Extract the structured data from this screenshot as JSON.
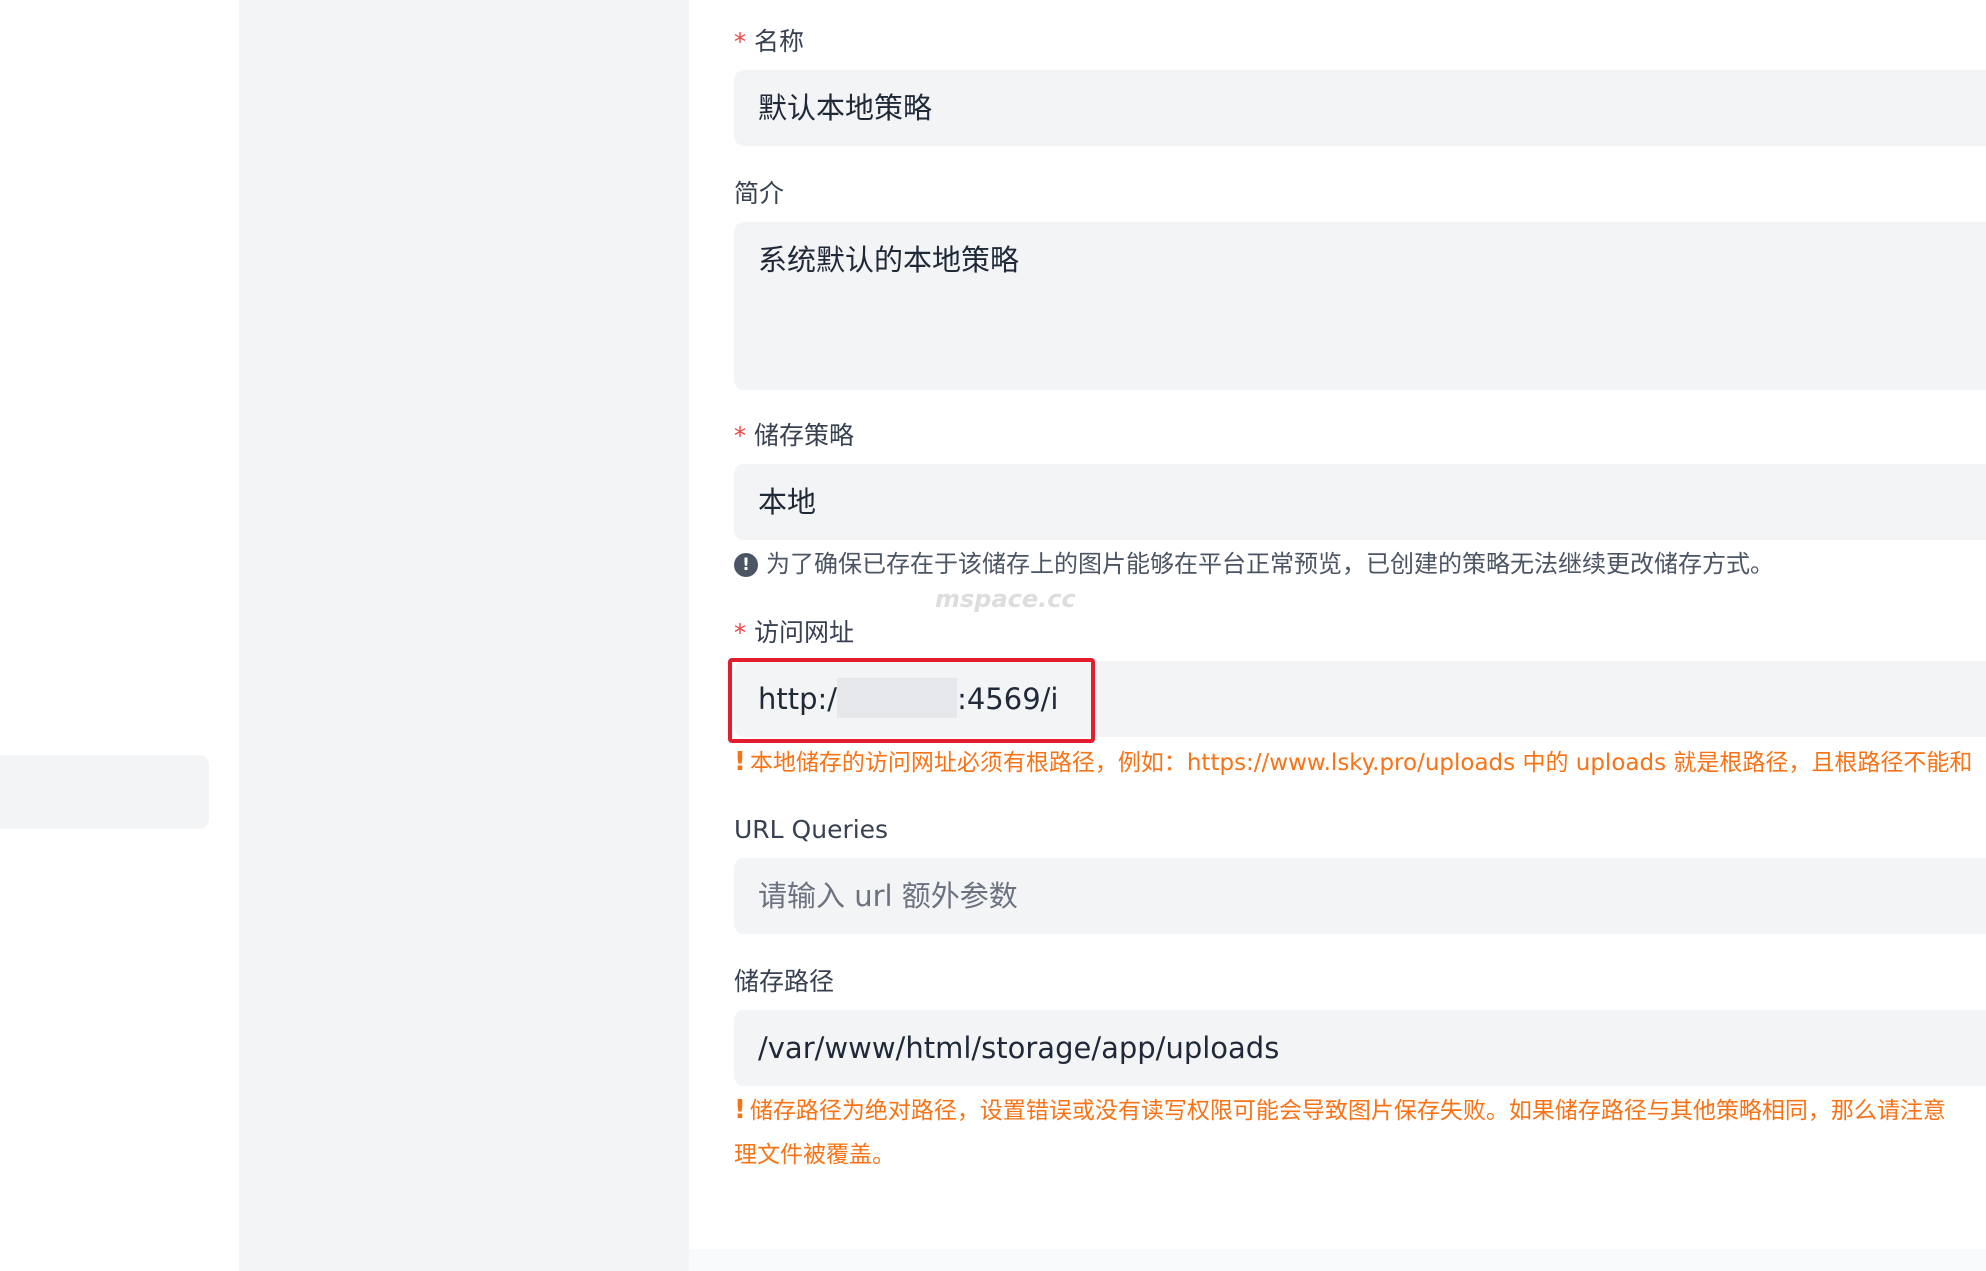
{
  "form": {
    "name": {
      "label": "名称",
      "required_mark": "*",
      "value": "默认本地策略"
    },
    "intro": {
      "label": "简介",
      "value": "系统默认的本地策略"
    },
    "storage_strategy": {
      "label": "储存策略",
      "required_mark": "*",
      "value": "本地",
      "hint": "为了确保已存在于该储存上的图片能够在平台正常预览，已创建的策略无法继续更改储存方式。"
    },
    "access_url": {
      "label": "访问网址",
      "required_mark": "*",
      "value_prefix": "http:/",
      "value_suffix": ":4569/i",
      "warning": "本地储存的访问网址必须有根路径，例如：https://www.lsky.pro/uploads 中的 uploads 就是根路径，且根路径不能和"
    },
    "url_queries": {
      "label": "URL Queries",
      "placeholder": "请输入 url 额外参数"
    },
    "storage_path": {
      "label": "储存路径",
      "value": "/var/www/html/storage/app/uploads",
      "warning_line1": "储存路径为绝对路径，设置错误或没有读写权限可能会导致图片保存失败。如果储存路径与其他策略相同，那么请注意",
      "warning_line2": "理文件被覆盖。"
    }
  },
  "watermark_text": "mspace.cc",
  "colors": {
    "required": "#ef4444",
    "warning": "#f97316",
    "highlight_box": "#e11d2e",
    "input_bg": "#f3f4f6"
  },
  "icons": {
    "info": "info-circle-icon",
    "warning": "exclamation-icon"
  }
}
